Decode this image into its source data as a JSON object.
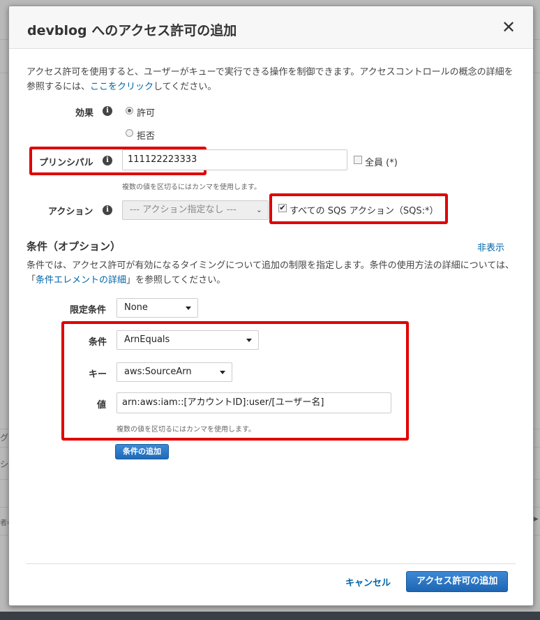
{
  "dialog": {
    "title": "devblog へのアクセス許可の追加",
    "close_label": "✕"
  },
  "intro": {
    "text_before": "アクセス許可を使用すると、ユーザーがキューで実行できる操作を制御できます。アクセスコントロールの概念の詳細を参照するには、",
    "link": "ここをクリック",
    "text_after": "してください。"
  },
  "effect": {
    "label": "効果",
    "info": "i",
    "options": [
      {
        "label": "許可",
        "selected": true
      },
      {
        "label": "拒否",
        "selected": false
      }
    ]
  },
  "principal": {
    "label": "プリンシパル",
    "info": "i",
    "value": "111122223333",
    "everyone_label": "全員",
    "everyone_suffix": "(*)",
    "hint": "複数の値を区切るにはカンマを使用します。"
  },
  "action": {
    "label": "アクション",
    "info": "i",
    "select_value": "--- アクション指定なし ---",
    "all_checkbox_label": "すべての SQS アクション（SQS:*）",
    "all_checked": true
  },
  "conditions": {
    "heading": "条件（オプション）",
    "hide_link": "非表示",
    "description_before": "条件では、アクセス許可が有効になるタイミングについて追加の制限を指定します。条件の使用方法の詳細については、「",
    "description_link": "条件エレメントの詳細",
    "description_after": "」を参照してください。",
    "qualifier_label": "限定条件",
    "qualifier_value": "None",
    "condition_label": "条件",
    "condition_value": "ArnEquals",
    "key_label": "キー",
    "key_value": "aws:SourceArn",
    "value_label": "値",
    "value_value": "arn:aws:iam::[アカウントID]:user/[ユーザー名]",
    "value_hint": "複数の値を区切るにはカンマを使用します。",
    "add_button": "条件の追加"
  },
  "footer": {
    "cancel": "キャンセル",
    "submit": "アクセス許可の追加"
  },
  "backdrop": {
    "frag1": "グ",
    "frag2": "シ",
    "frag3": "者の"
  },
  "colors": {
    "highlight": "#e00000",
    "primary": "#1e66b3",
    "link": "#0066aa"
  }
}
